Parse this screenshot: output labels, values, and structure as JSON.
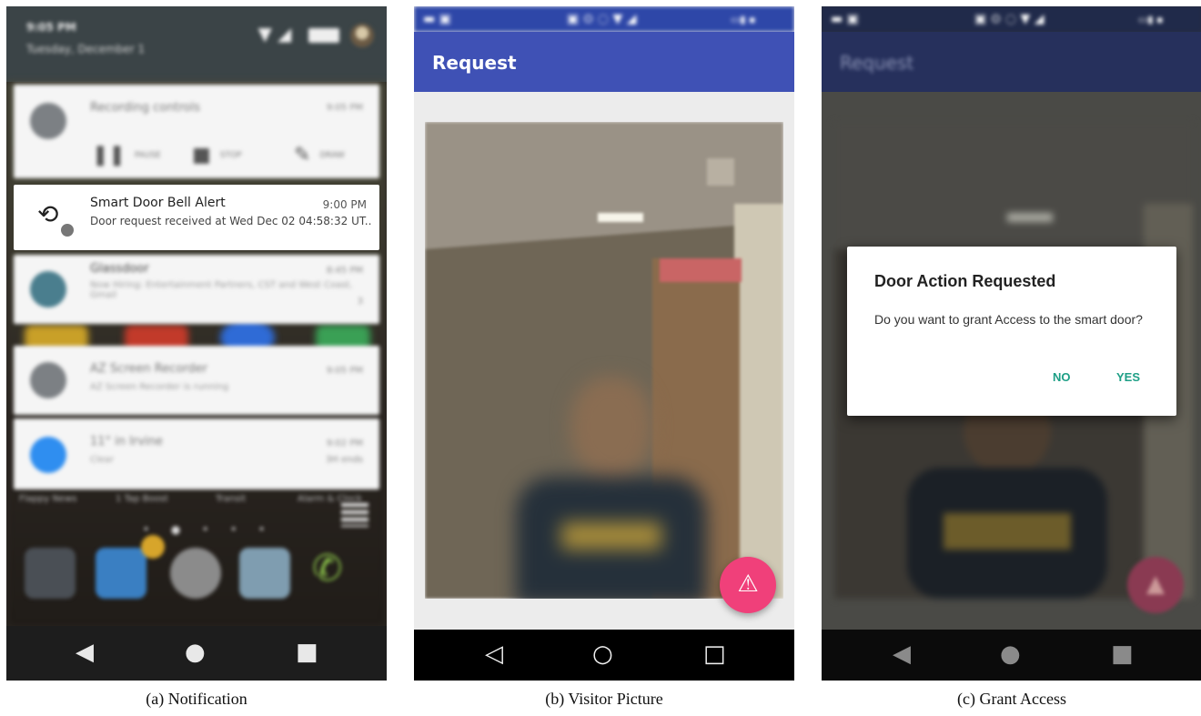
{
  "captions": {
    "a": "(a) Notification",
    "b": "(b) Visitor Picture",
    "c": "(c) Grant Access"
  },
  "notification_panel": {
    "status_time": "9:05 PM",
    "status_date": "Tuesday, December 1",
    "notifications": [
      {
        "title": "Recording controls",
        "time": "9:05 PM",
        "controls": [
          "PAUSE",
          "STOP",
          "DRAW"
        ]
      },
      {
        "title": "Smart Door Bell Alert",
        "time": "9:00 PM",
        "text": "Door request received at Wed Dec 02 04:58:32 UT.."
      },
      {
        "title": "Glassdoor",
        "time": "8:45 PM",
        "text": "Now Hiring: Entertainment Partners, CST and West Coast, Gmail",
        "count": "3"
      },
      {
        "title": "AZ Screen Recorder",
        "time": "9:05 PM",
        "text": "AZ Screen Recorder is running"
      },
      {
        "title": "11° in Irvine",
        "time": "9:02 PM",
        "text": "Clear",
        "extra": "3H ends"
      }
    ],
    "home_labels": [
      "Flappy News",
      "1 Tap Boost",
      "Transit",
      "Alarm & Clock"
    ],
    "colors": {
      "recording_icon": "#7c8084",
      "smart_icon": "#222222",
      "glassdoor_icon": "#4a7e8e",
      "weather_icon": "#2f8ef0"
    }
  },
  "request_screen": {
    "app_title": "Request",
    "fab_icon": "warning-icon",
    "colors": {
      "app_bar": "#3f51b5",
      "fab": "#f0407a"
    }
  },
  "grant_screen": {
    "app_title": "Request",
    "dialog": {
      "title": "Door Action Requested",
      "message": "Do you want to grant Access to the smart door?",
      "no": "NO",
      "yes": "YES"
    },
    "colors": {
      "dialog_buttons": "#1e9f86"
    }
  }
}
